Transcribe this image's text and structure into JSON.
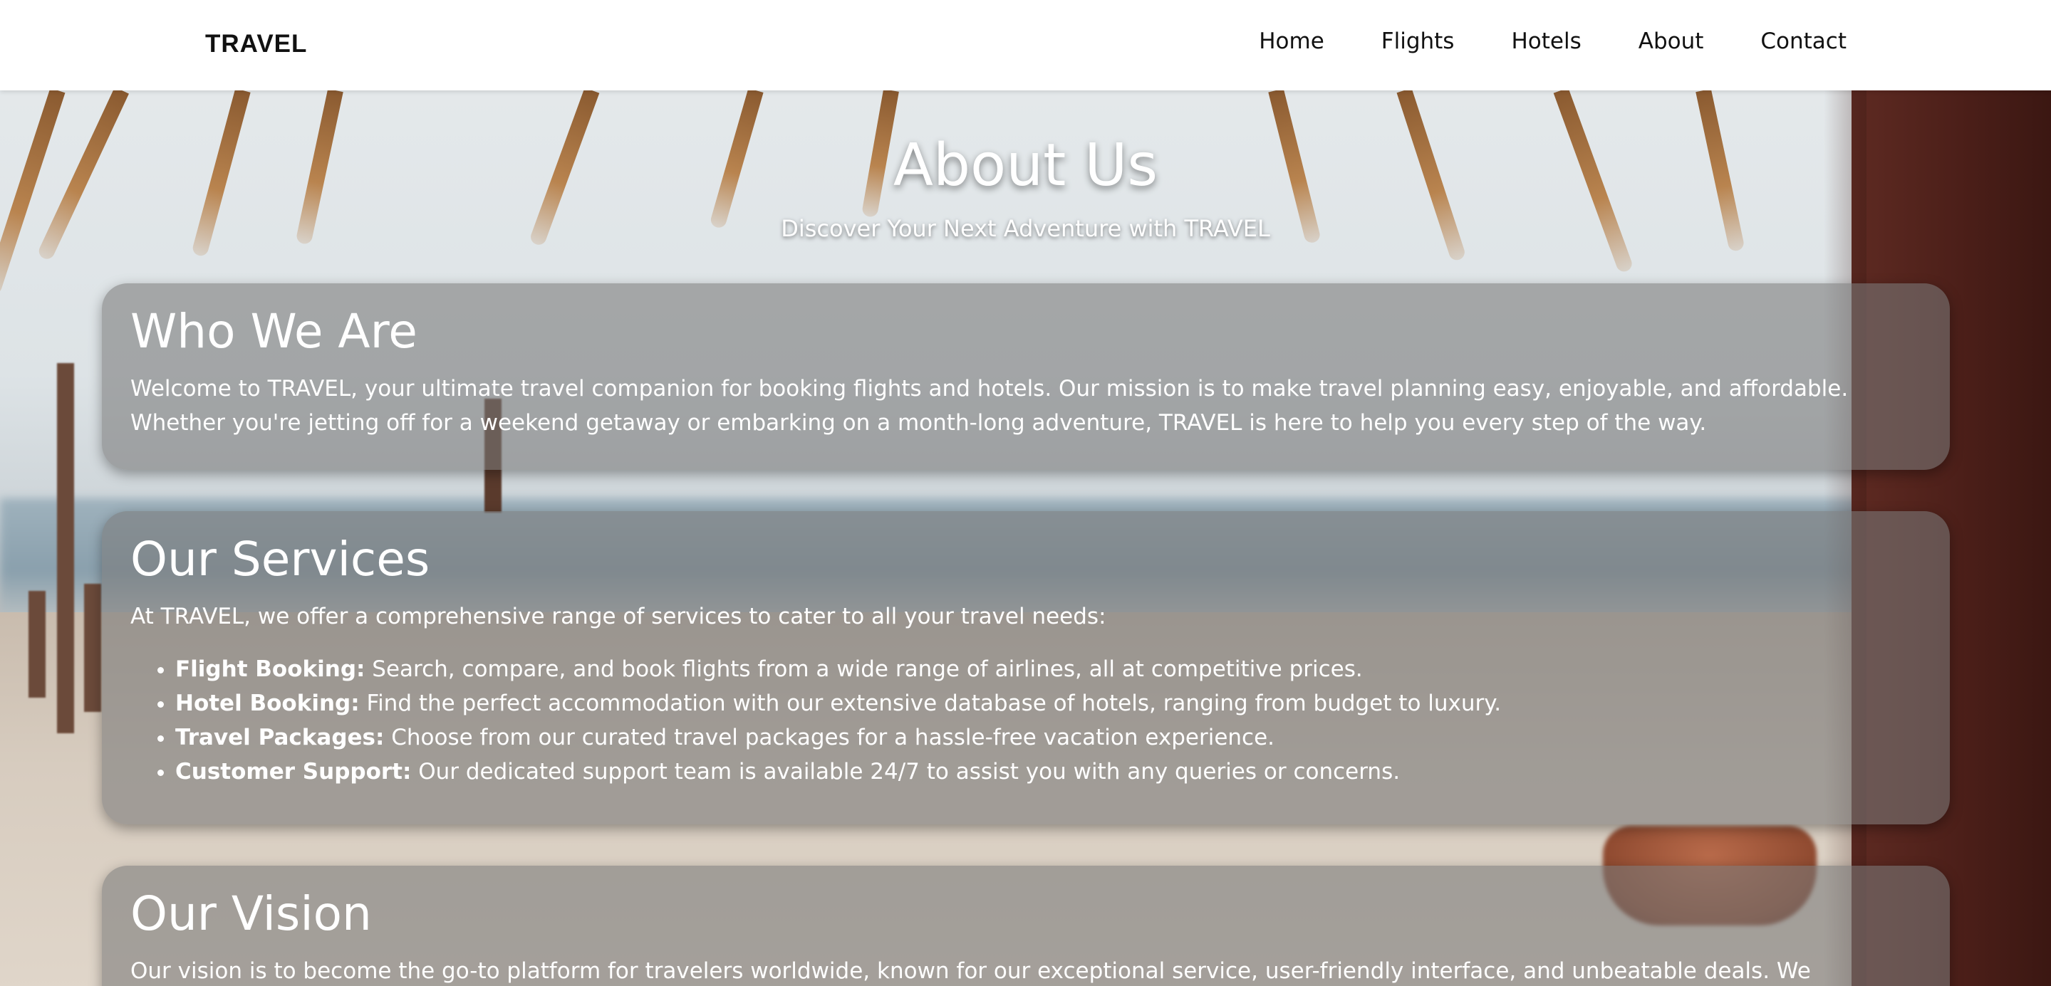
{
  "navbar": {
    "brand": "TRAVEL",
    "links": [
      "Home",
      "Flights",
      "Hotels",
      "About",
      "Contact"
    ]
  },
  "hero": {
    "title": "About Us",
    "subtitle": "Discover Your Next Adventure with TRAVEL"
  },
  "sections": {
    "who": {
      "title": "Who We Are",
      "text": "Welcome to TRAVEL, your ultimate travel companion for booking flights and hotels. Our mission is to make travel planning easy, enjoyable, and affordable. Whether you're jetting off for a weekend getaway or embarking on a month-long adventure, TRAVEL is here to help you every step of the way."
    },
    "services": {
      "title": "Our Services",
      "intro": "At TRAVEL, we offer a comprehensive range of services to cater to all your travel needs:",
      "items": [
        {
          "label": "Flight Booking:",
          "text": " Search, compare, and book flights from a wide range of airlines, all at competitive prices."
        },
        {
          "label": "Hotel Booking:",
          "text": " Find the perfect accommodation with our extensive database of hotels, ranging from budget to luxury."
        },
        {
          "label": "Travel Packages:",
          "text": " Choose from our curated travel packages for a hassle-free vacation experience."
        },
        {
          "label": "Customer Support:",
          "text": " Our dedicated support team is available 24/7 to assist you with any queries or concerns."
        }
      ]
    },
    "vision": {
      "title": "Our Vision",
      "text": "Our vision is to become the go-to platform for travelers worldwide, known for our exceptional service, user-friendly interface, and unbeatable deals. We"
    }
  }
}
